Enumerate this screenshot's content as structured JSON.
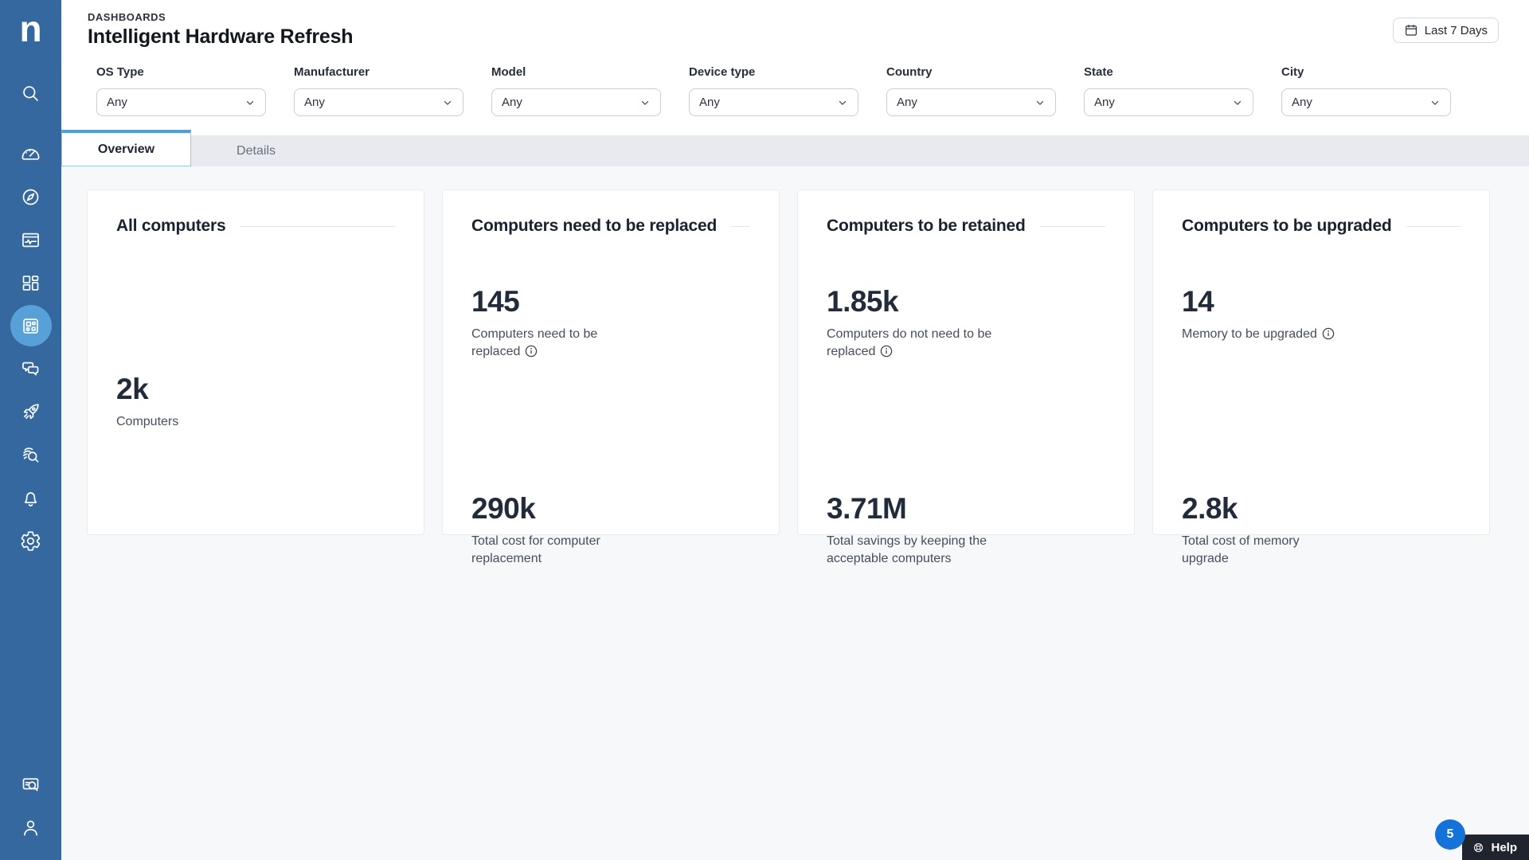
{
  "colors": {
    "sidebar": "#35689e",
    "accent": "#4aa0e4",
    "badge": "#1472d8",
    "help_bg": "#20242e",
    "page_bg": "#f7f8fa",
    "strip_bg": "#e8eaef"
  },
  "sidebar": {
    "logo": "n",
    "icons": [
      "search-icon",
      "dashboard-gauge-icon",
      "compass-icon",
      "window-activity-icon",
      "layout-grid-icon",
      "apps-dashboard-icon",
      "chat-icon",
      "rocket-icon",
      "fingerprint-search-icon",
      "bell-icon",
      "gear-icon",
      "device-search-icon",
      "user-icon"
    ],
    "active_icon": "apps-dashboard-icon"
  },
  "header": {
    "breadcrumb": "DASHBOARDS",
    "title": "Intelligent Hardware Refresh",
    "date_range_button": "Last 7 Days"
  },
  "filters": [
    {
      "label": "OS Type",
      "value": "Any"
    },
    {
      "label": "Manufacturer",
      "value": "Any"
    },
    {
      "label": "Model",
      "value": "Any"
    },
    {
      "label": "Device type",
      "value": "Any"
    },
    {
      "label": "Country",
      "value": "Any"
    },
    {
      "label": "State",
      "value": "Any"
    },
    {
      "label": "City",
      "value": "Any"
    }
  ],
  "tabs": [
    {
      "label": "Overview",
      "active": true
    },
    {
      "label": "Details",
      "active": false
    }
  ],
  "cards": [
    {
      "title": "All computers",
      "stats": [
        {
          "value": "2k",
          "label": "Computers",
          "info": false
        }
      ]
    },
    {
      "title": "Computers need to be replaced",
      "stats": [
        {
          "value": "145",
          "label": "Computers need to be replaced",
          "info": true
        },
        {
          "value": "290k",
          "label": "Total cost for computer replacement",
          "info": false
        }
      ]
    },
    {
      "title": "Computers to be retained",
      "stats": [
        {
          "value": "1.85k",
          "label": "Computers do not need to be replaced",
          "info": true
        },
        {
          "value": "3.71M",
          "label": "Total savings by keeping the acceptable computers",
          "info": false
        }
      ]
    },
    {
      "title": "Computers to be upgraded",
      "stats": [
        {
          "value": "14",
          "label": "Memory to be upgraded",
          "info": true
        },
        {
          "value": "2.8k",
          "label": "Total cost of memory upgrade",
          "info": false
        }
      ]
    }
  ],
  "help": {
    "label": "Help",
    "badge": "5"
  }
}
